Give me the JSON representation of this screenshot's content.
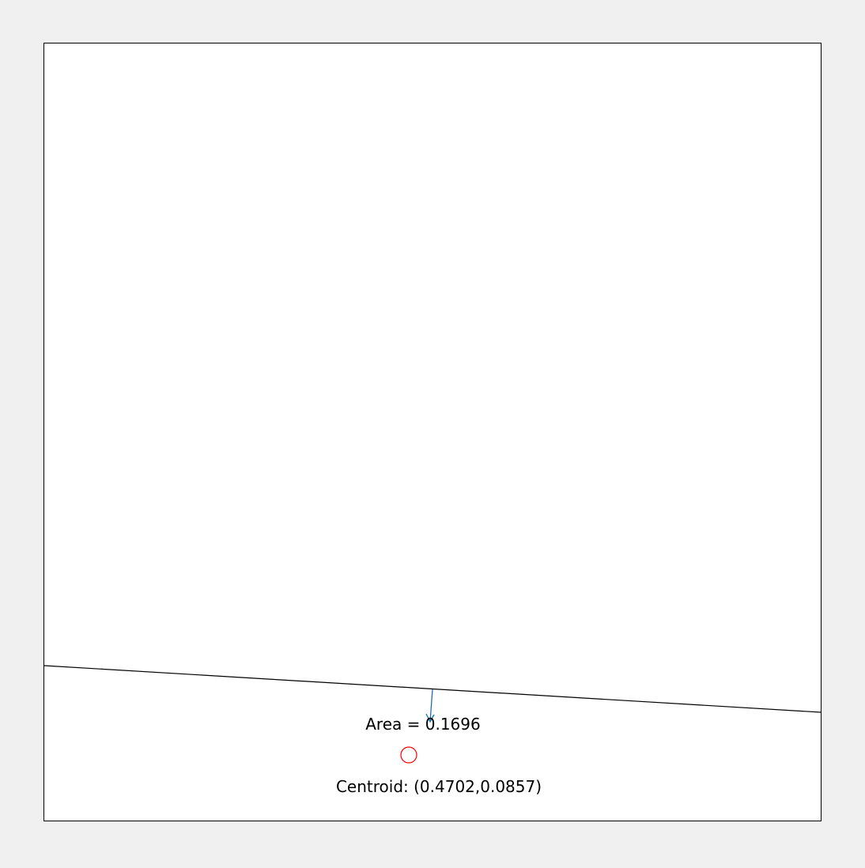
{
  "figure": {
    "background": "#f0f0f0",
    "axes_background": "#ffffff"
  },
  "diagram": {
    "area_label": "Area = 0.1696",
    "centroid_label": "Centroid: (0.4702,0.0857)",
    "line_color": "#000000",
    "arrow_color": "#1f6fa8",
    "centroid_marker_color": "#ff0000",
    "centroid_marker_icon": "circle-marker"
  }
}
